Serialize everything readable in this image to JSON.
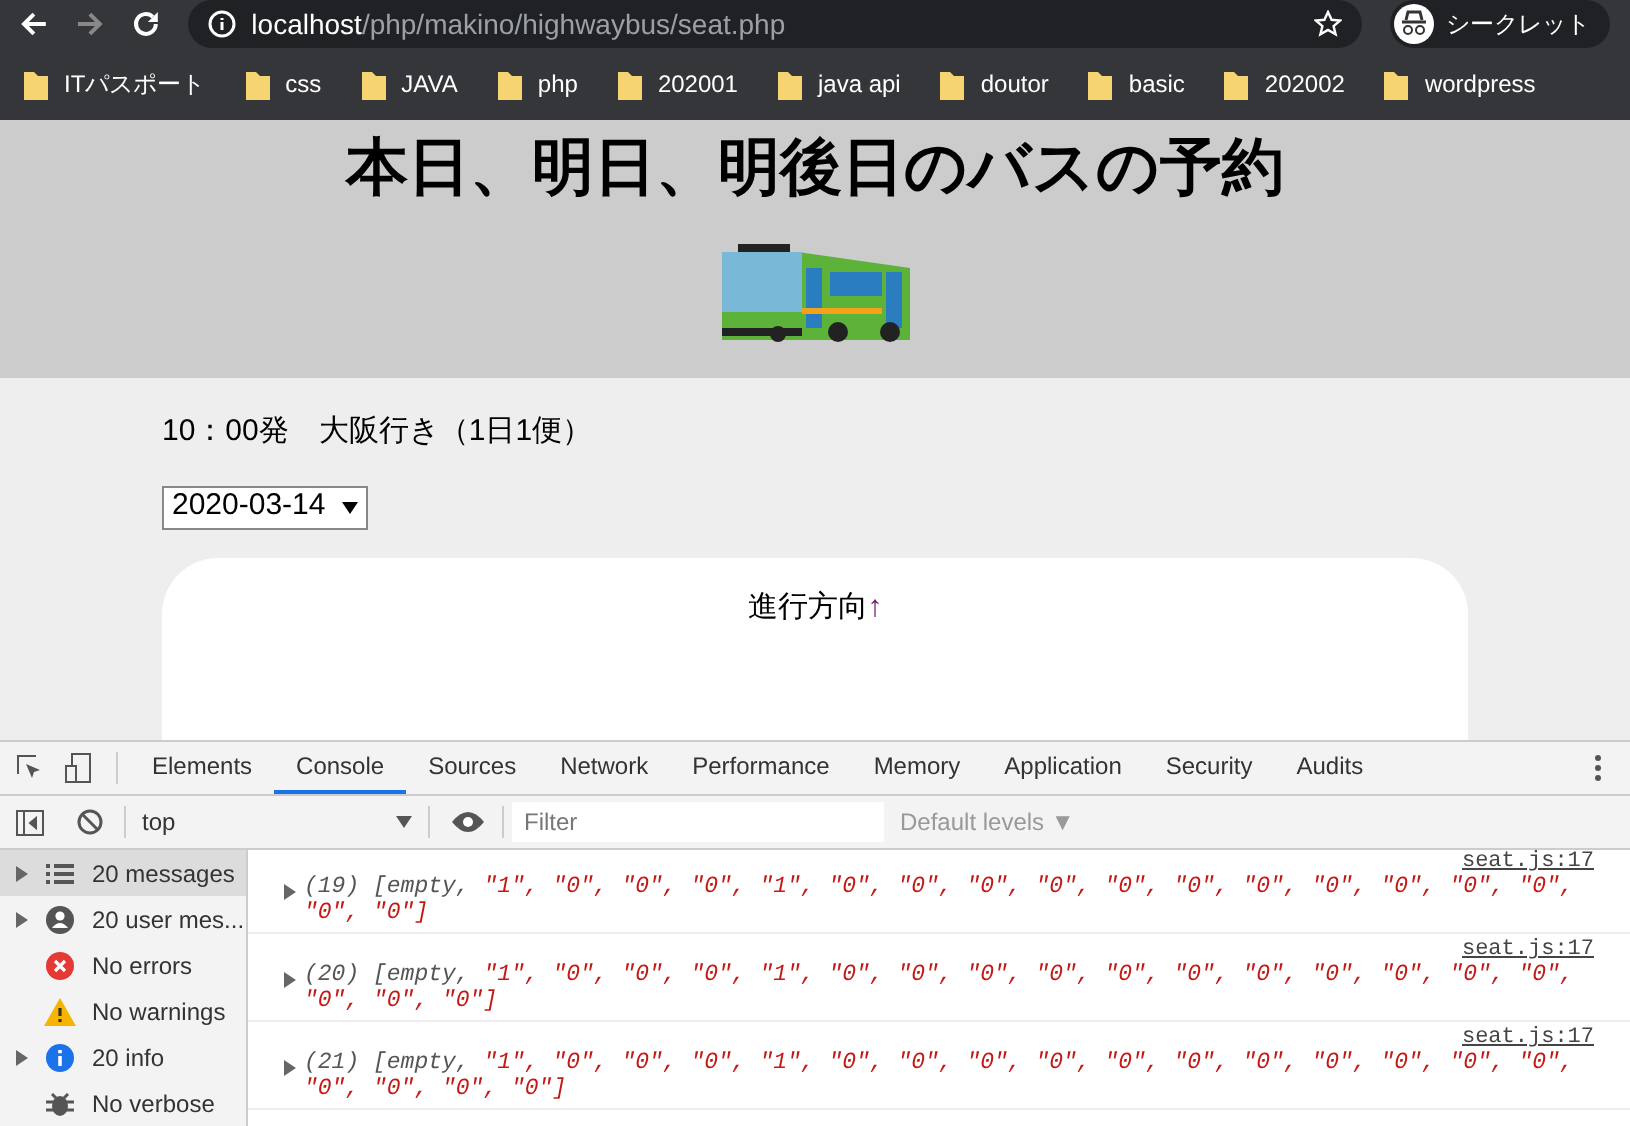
{
  "browser": {
    "url_host": "localhost",
    "url_path": "/php/makino/highwaybus/seat.php",
    "profile": "シークレット",
    "bookmarks": [
      "ITパスポート",
      "css",
      "JAVA",
      "php",
      "202001",
      "java api",
      "doutor",
      "basic",
      "202002",
      "wordpress"
    ]
  },
  "page": {
    "title": "本日、明日、明後日のバスの予約",
    "departure": "10：00発　大阪行き（1日1便）",
    "date_select": "2020-03-14",
    "direction_label": "進行方向",
    "direction_arrow": "↑"
  },
  "devtools": {
    "tabs": [
      {
        "label": "Elements",
        "selected": false
      },
      {
        "label": "Console",
        "selected": true
      },
      {
        "label": "Sources",
        "selected": false
      },
      {
        "label": "Network",
        "selected": false
      },
      {
        "label": "Performance",
        "selected": false
      },
      {
        "label": "Memory",
        "selected": false
      },
      {
        "label": "Application",
        "selected": false
      },
      {
        "label": "Security",
        "selected": false
      },
      {
        "label": "Audits",
        "selected": false
      }
    ],
    "context": "top",
    "filter_placeholder": "Filter",
    "levels": "Default levels ▼",
    "sidebar": [
      {
        "kind": "list",
        "label": "20 messages",
        "selected": true,
        "expandable": true
      },
      {
        "kind": "user",
        "label": "20 user mes...",
        "selected": false,
        "expandable": true
      },
      {
        "kind": "error",
        "label": "No errors",
        "selected": false,
        "expandable": false
      },
      {
        "kind": "warning",
        "label": "No warnings",
        "selected": false,
        "expandable": false
      },
      {
        "kind": "info",
        "label": "20 info",
        "selected": false,
        "expandable": true
      },
      {
        "kind": "verbose",
        "label": "No verbose",
        "selected": false,
        "expandable": false
      }
    ],
    "logs": [
      {
        "source": "seat.js:17",
        "length": "(19)",
        "open": "[empty,",
        "values": [
          "\"1\",",
          "\"0\",",
          "\"0\",",
          "\"0\",",
          "\"1\",",
          "\"0\",",
          "\"0\",",
          "\"0\",",
          "\"0\",",
          "\"0\",",
          "\"0\",",
          "\"0\",",
          "\"0\",",
          "\"0\",",
          "\"0\",",
          "\"0\",",
          "\"0\",",
          "\"0\"]"
        ]
      },
      {
        "source": "seat.js:17",
        "length": "(20)",
        "open": "[empty,",
        "values": [
          "\"1\",",
          "\"0\",",
          "\"0\",",
          "\"0\",",
          "\"1\",",
          "\"0\",",
          "\"0\",",
          "\"0\",",
          "\"0\",",
          "\"0\",",
          "\"0\",",
          "\"0\",",
          "\"0\",",
          "\"0\",",
          "\"0\",",
          "\"0\",",
          "\"0\",",
          "\"0\",",
          "\"0\"]"
        ]
      },
      {
        "source": "seat.js:17",
        "length": "(21)",
        "open": "[empty,",
        "values": [
          "\"1\",",
          "\"0\",",
          "\"0\",",
          "\"0\",",
          "\"1\",",
          "\"0\",",
          "\"0\",",
          "\"0\",",
          "\"0\",",
          "\"0\",",
          "\"0\",",
          "\"0\",",
          "\"0\",",
          "\"0\",",
          "\"0\",",
          "\"0\",",
          "\"0\",",
          "\"0\",",
          "\"0\",",
          "\"0\"]"
        ]
      }
    ]
  }
}
